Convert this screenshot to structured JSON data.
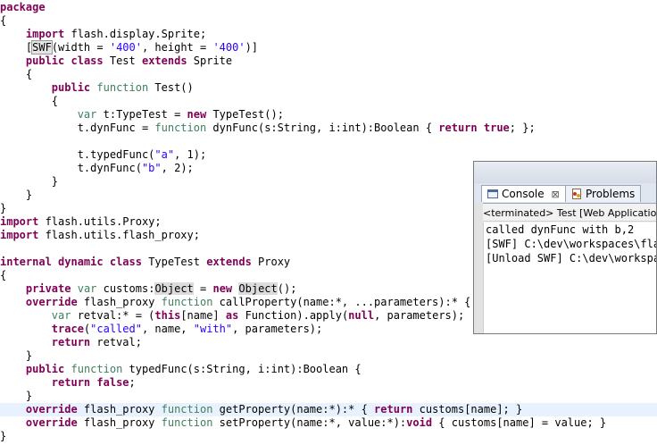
{
  "editor": {
    "lines": [
      [
        {
          "t": "package",
          "c": "kw"
        }
      ],
      [
        {
          "t": "{"
        }
      ],
      [
        {
          "t": "    "
        },
        {
          "t": "import",
          "c": "kw"
        },
        {
          "t": " flash.display.Sprite;"
        }
      ],
      [
        {
          "t": "    ["
        },
        {
          "t": "SWF",
          "c": "box"
        },
        {
          "t": "(width = "
        },
        {
          "t": "'400'",
          "c": "str"
        },
        {
          "t": ", height = "
        },
        {
          "t": "'400'",
          "c": "str"
        },
        {
          "t": ")]"
        }
      ],
      [
        {
          "t": "    "
        },
        {
          "t": "public",
          "c": "kw"
        },
        {
          "t": " "
        },
        {
          "t": "class",
          "c": "kw"
        },
        {
          "t": " Test "
        },
        {
          "t": "extends",
          "c": "kw"
        },
        {
          "t": " Sprite"
        }
      ],
      [
        {
          "t": "    {"
        }
      ],
      [
        {
          "t": "        "
        },
        {
          "t": "public",
          "c": "kw"
        },
        {
          "t": " "
        },
        {
          "t": "function",
          "c": "fnkw"
        },
        {
          "t": " Test()"
        }
      ],
      [
        {
          "t": "        {"
        }
      ],
      [
        {
          "t": "            "
        },
        {
          "t": "var",
          "c": "kw2"
        },
        {
          "t": " t:TypeTest = "
        },
        {
          "t": "new",
          "c": "kw"
        },
        {
          "t": " TypeTest();"
        }
      ],
      [
        {
          "t": "            t.dynFunc = "
        },
        {
          "t": "function",
          "c": "fnkw"
        },
        {
          "t": " dynFunc(s:String, i:int):Boolean { "
        },
        {
          "t": "return",
          "c": "kw"
        },
        {
          "t": " "
        },
        {
          "t": "true",
          "c": "kw"
        },
        {
          "t": "; };"
        }
      ],
      [
        {
          "t": ""
        }
      ],
      [
        {
          "t": "            t.typedFunc("
        },
        {
          "t": "\"a\"",
          "c": "str"
        },
        {
          "t": ", 1);"
        }
      ],
      [
        {
          "t": "            t.dynFunc("
        },
        {
          "t": "\"b\"",
          "c": "str"
        },
        {
          "t": ", 2);"
        }
      ],
      [
        {
          "t": "        }"
        }
      ],
      [
        {
          "t": "    }"
        }
      ],
      [
        {
          "t": "}"
        }
      ],
      [
        {
          "t": "import",
          "c": "kw"
        },
        {
          "t": " flash.utils.Proxy;"
        }
      ],
      [
        {
          "t": "import",
          "c": "kw"
        },
        {
          "t": " flash.utils.flash_proxy;"
        }
      ],
      [
        {
          "t": ""
        }
      ],
      [
        {
          "t": "internal",
          "c": "kw"
        },
        {
          "t": " "
        },
        {
          "t": "dynamic",
          "c": "kw"
        },
        {
          "t": " "
        },
        {
          "t": "class",
          "c": "kw"
        },
        {
          "t": " TypeTest "
        },
        {
          "t": "extends",
          "c": "kw"
        },
        {
          "t": " Proxy"
        }
      ],
      [
        {
          "t": "{"
        }
      ],
      [
        {
          "t": "    "
        },
        {
          "t": "private",
          "c": "kw"
        },
        {
          "t": " "
        },
        {
          "t": "var",
          "c": "kw2"
        },
        {
          "t": " customs:"
        },
        {
          "t": "Object",
          "c": "obj"
        },
        {
          "t": " = "
        },
        {
          "t": "new",
          "c": "kw"
        },
        {
          "t": " "
        },
        {
          "t": "Object",
          "c": "obj"
        },
        {
          "t": "();"
        }
      ],
      [
        {
          "t": "    "
        },
        {
          "t": "override",
          "c": "kw"
        },
        {
          "t": " flash_proxy "
        },
        {
          "t": "function",
          "c": "fnkw"
        },
        {
          "t": " callProperty(name:*, ...parameters):* {"
        }
      ],
      [
        {
          "t": "        "
        },
        {
          "t": "var",
          "c": "kw2"
        },
        {
          "t": " retval:* = ("
        },
        {
          "t": "this",
          "c": "kw"
        },
        {
          "t": "[name] "
        },
        {
          "t": "as",
          "c": "kw"
        },
        {
          "t": " Function).apply("
        },
        {
          "t": "null",
          "c": "kw"
        },
        {
          "t": ", parameters);"
        }
      ],
      [
        {
          "t": "        "
        },
        {
          "t": "trace",
          "c": "kw"
        },
        {
          "t": "("
        },
        {
          "t": "\"called\"",
          "c": "str"
        },
        {
          "t": ", name, "
        },
        {
          "t": "\"with\"",
          "c": "str"
        },
        {
          "t": ", parameters);"
        }
      ],
      [
        {
          "t": "        "
        },
        {
          "t": "return",
          "c": "kw"
        },
        {
          "t": " retval;"
        }
      ],
      [
        {
          "t": "    }"
        }
      ],
      [
        {
          "t": "    "
        },
        {
          "t": "public",
          "c": "kw"
        },
        {
          "t": " "
        },
        {
          "t": "function",
          "c": "fnkw"
        },
        {
          "t": " typedFunc(s:String, i:int):Boolean {"
        }
      ],
      [
        {
          "t": "        "
        },
        {
          "t": "return",
          "c": "kw"
        },
        {
          "t": " "
        },
        {
          "t": "false",
          "c": "kw"
        },
        {
          "t": ";"
        }
      ],
      [
        {
          "t": "    }"
        }
      ],
      [
        {
          "t": "    "
        },
        {
          "t": "override",
          "c": "kw"
        },
        {
          "t": " flash_proxy "
        },
        {
          "t": "function",
          "c": "fnkw"
        },
        {
          "t": " getProperty(name:*):* { "
        },
        {
          "t": "return",
          "c": "kw"
        },
        {
          "t": " customs[name]; }"
        }
      ],
      [
        {
          "t": "    "
        },
        {
          "t": "override",
          "c": "kw"
        },
        {
          "t": " flash_proxy "
        },
        {
          "t": "function",
          "c": "fnkw"
        },
        {
          "t": " setProperty(name:*, value:*):"
        },
        {
          "t": "void",
          "c": "kw"
        },
        {
          "t": " { customs[name] = value; }"
        }
      ],
      [
        {
          "t": "}"
        }
      ]
    ],
    "highlight_line": 30
  },
  "console": {
    "tab_console": "Console",
    "tab_console_close": "⊠",
    "tab_problems": "Problems",
    "status": "<terminated> Test [Web Application",
    "output": [
      "called dynFunc with b,2",
      "[SWF] C:\\dev\\workspaces\\flas",
      "[Unload SWF] C:\\dev\\workspac"
    ]
  }
}
